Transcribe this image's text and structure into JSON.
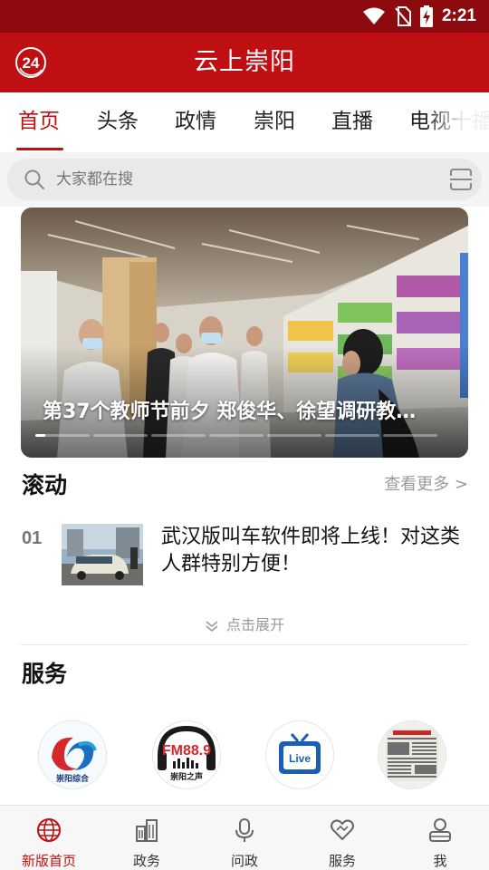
{
  "status_bar": {
    "time": "2:21"
  },
  "header": {
    "title": "云上崇阳",
    "badge_icon": "24-badge-icon"
  },
  "tabs": [
    {
      "label": "首页",
      "active": true
    },
    {
      "label": "头条",
      "active": false
    },
    {
      "label": "政情",
      "active": false
    },
    {
      "label": "崇阳",
      "active": false
    },
    {
      "label": "直播",
      "active": false
    },
    {
      "label": "电视十播",
      "active": false
    }
  ],
  "search": {
    "placeholder": "大家都在搜"
  },
  "banner": {
    "caption": "第37个教师节前夕 郑俊华、徐望调研教…"
  },
  "rolling": {
    "title": "滚动",
    "see_more": "查看更多 >",
    "items": [
      {
        "rank": "01",
        "title": "武汉版叫车软件即将上线！对这类人群特别方便！"
      }
    ],
    "expand_label": "点击展开"
  },
  "services": {
    "title": "服务",
    "items": [
      {
        "icon": "chongyang-tv-logo",
        "text": "崇阳综合"
      },
      {
        "icon": "fm-radio-logo",
        "text": "FM88.9",
        "subtext": "崇阳之声"
      },
      {
        "icon": "live-tv-logo",
        "text": "Live"
      },
      {
        "icon": "newspaper-icon",
        "text": ""
      }
    ]
  },
  "bottom_nav": [
    {
      "label": "新版首页",
      "icon": "globe-icon",
      "active": true
    },
    {
      "label": "政务",
      "icon": "buildings-icon",
      "active": false
    },
    {
      "label": "问政",
      "icon": "microphone-icon",
      "active": false
    },
    {
      "label": "服务",
      "icon": "heart-hands-icon",
      "active": false
    },
    {
      "label": "我",
      "icon": "person-icon",
      "active": false
    }
  ],
  "colors": {
    "brand_red": "#c00f12",
    "status_bar": "#8d0a0e"
  }
}
